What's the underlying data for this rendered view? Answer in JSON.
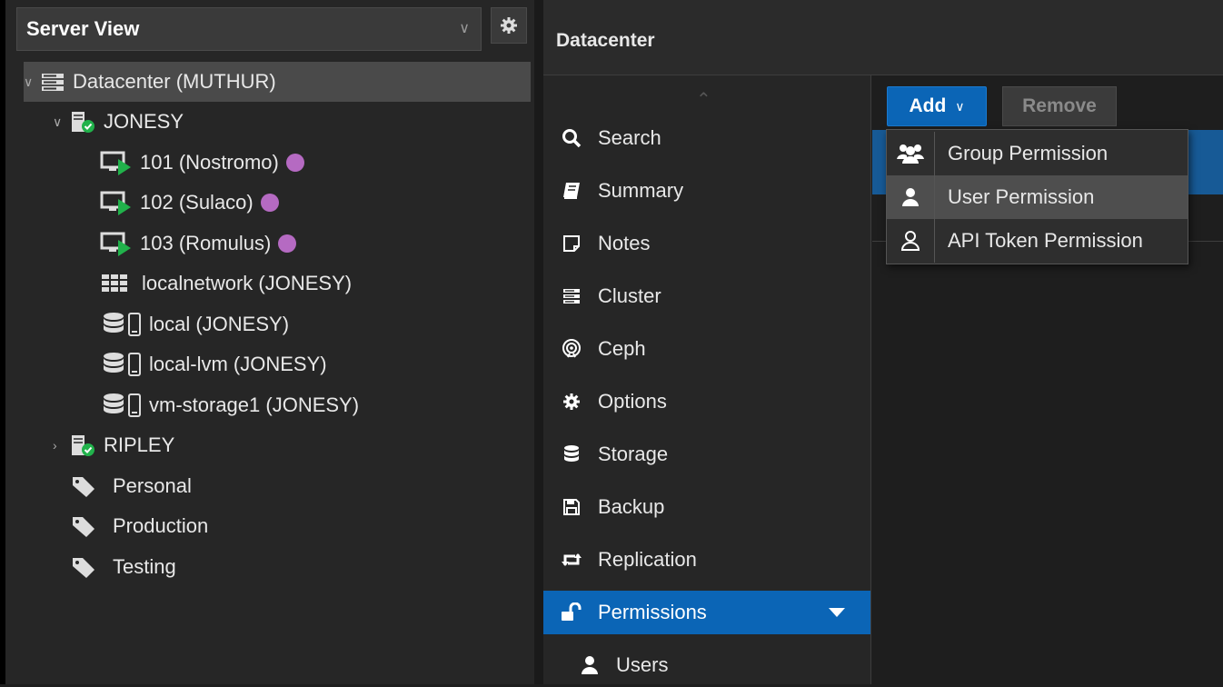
{
  "left": {
    "view_selector": "Server View",
    "tree": [
      {
        "label": "Datacenter (MUTHUR)",
        "icon": "datacenter-icon",
        "expander": "open"
      },
      {
        "label": "JONESY",
        "icon": "node-online-icon",
        "expander": "open"
      },
      {
        "label": "101 (Nostromo)",
        "icon": "vm-running-icon",
        "tag_color": "#b56ac2"
      },
      {
        "label": "102 (Sulaco)",
        "icon": "vm-running-icon",
        "tag_color": "#b56ac2"
      },
      {
        "label": "103 (Romulus)",
        "icon": "vm-running-icon",
        "tag_color": "#b56ac2"
      },
      {
        "label": "localnetwork (JONESY)",
        "icon": "network-grid-icon"
      },
      {
        "label": "local (JONESY)",
        "icon": "storage-icon"
      },
      {
        "label": "local-lvm (JONESY)",
        "icon": "storage-icon"
      },
      {
        "label": "vm-storage1 (JONESY)",
        "icon": "storage-icon"
      },
      {
        "label": "RIPLEY",
        "icon": "node-online-icon",
        "expander": "closed"
      },
      {
        "label": "Personal",
        "icon": "tag-icon"
      },
      {
        "label": "Production",
        "icon": "tag-icon"
      },
      {
        "label": "Testing",
        "icon": "tag-icon"
      }
    ]
  },
  "header": {
    "title": "Datacenter"
  },
  "nav": {
    "items": [
      {
        "label": "Search",
        "icon": "search-icon"
      },
      {
        "label": "Summary",
        "icon": "book-icon"
      },
      {
        "label": "Notes",
        "icon": "note-icon"
      },
      {
        "label": "Cluster",
        "icon": "server-icon"
      },
      {
        "label": "Ceph",
        "icon": "ceph-icon"
      },
      {
        "label": "Options",
        "icon": "gear-icon"
      },
      {
        "label": "Storage",
        "icon": "database-icon"
      },
      {
        "label": "Backup",
        "icon": "floppy-icon"
      },
      {
        "label": "Replication",
        "icon": "retweet-icon"
      },
      {
        "label": "Permissions",
        "icon": "unlock-icon",
        "active": true
      },
      {
        "label": "Users",
        "icon": "user-icon"
      }
    ]
  },
  "toolbar": {
    "add_label": "Add",
    "remove_label": "Remove"
  },
  "dropdown": {
    "items": [
      {
        "label": "Group Permission",
        "icon": "group-icon"
      },
      {
        "label": "User Permission",
        "icon": "user-icon",
        "hover": true
      },
      {
        "label": "API Token Permission",
        "icon": "user-outline-icon"
      }
    ]
  },
  "colors": {
    "accent": "#0b65b6",
    "tag": "#b56ac2",
    "running": "#21b24b"
  }
}
